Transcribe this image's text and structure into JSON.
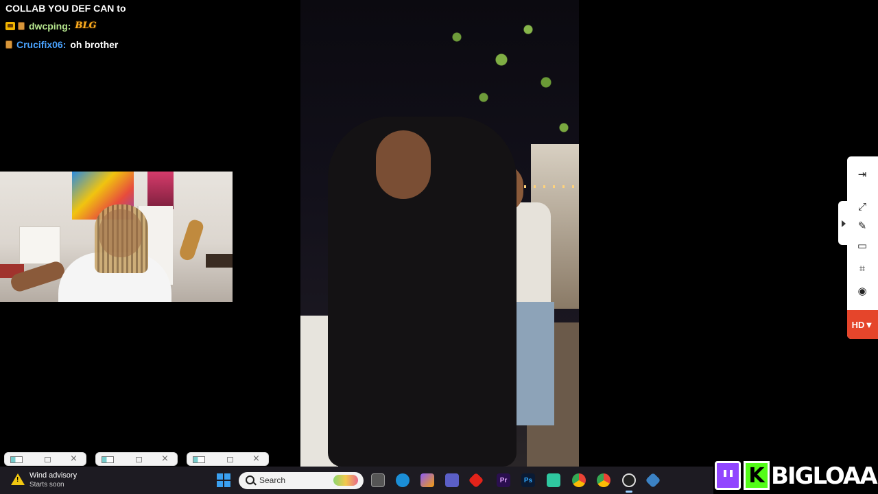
{
  "chat": {
    "lines": [
      {
        "message": "COLLAB YOU DEF CAN to"
      },
      {
        "username": "dwcping",
        "emote_text": "BLG"
      },
      {
        "username": "Crucifix06",
        "message": "oh brother"
      }
    ]
  },
  "toolbar": {
    "icons": [
      "exit-icon",
      "fullscreen-icon",
      "pen-icon",
      "screenshot-icon",
      "crop-icon",
      "record-icon"
    ],
    "hd_label": "HD▼",
    "accent_color": "#e5452b"
  },
  "mini_windows": [
    {
      "close_glyph": "×"
    },
    {
      "close_glyph": "×"
    },
    {
      "close_glyph": "×"
    }
  ],
  "taskbar": {
    "weather_title": "Wind advisory",
    "weather_subtitle": "Starts soon",
    "search_placeholder": "Search",
    "apps": [
      "files-icon",
      "edge-icon",
      "copilot-icon",
      "teams-icon",
      "acrobat-icon",
      "premiere-icon",
      "photoshop-icon",
      "obs-icon",
      "chrome-beta-icon",
      "chrome-icon",
      "obs-studio-icon",
      "app-icon"
    ],
    "premiere_label": "Pr",
    "photoshop_label": "Ps"
  },
  "watermark": {
    "name": "BIGLOAAF",
    "kick_letter": "K",
    "twitch_color": "#9146ff",
    "kick_color": "#53fc18"
  }
}
